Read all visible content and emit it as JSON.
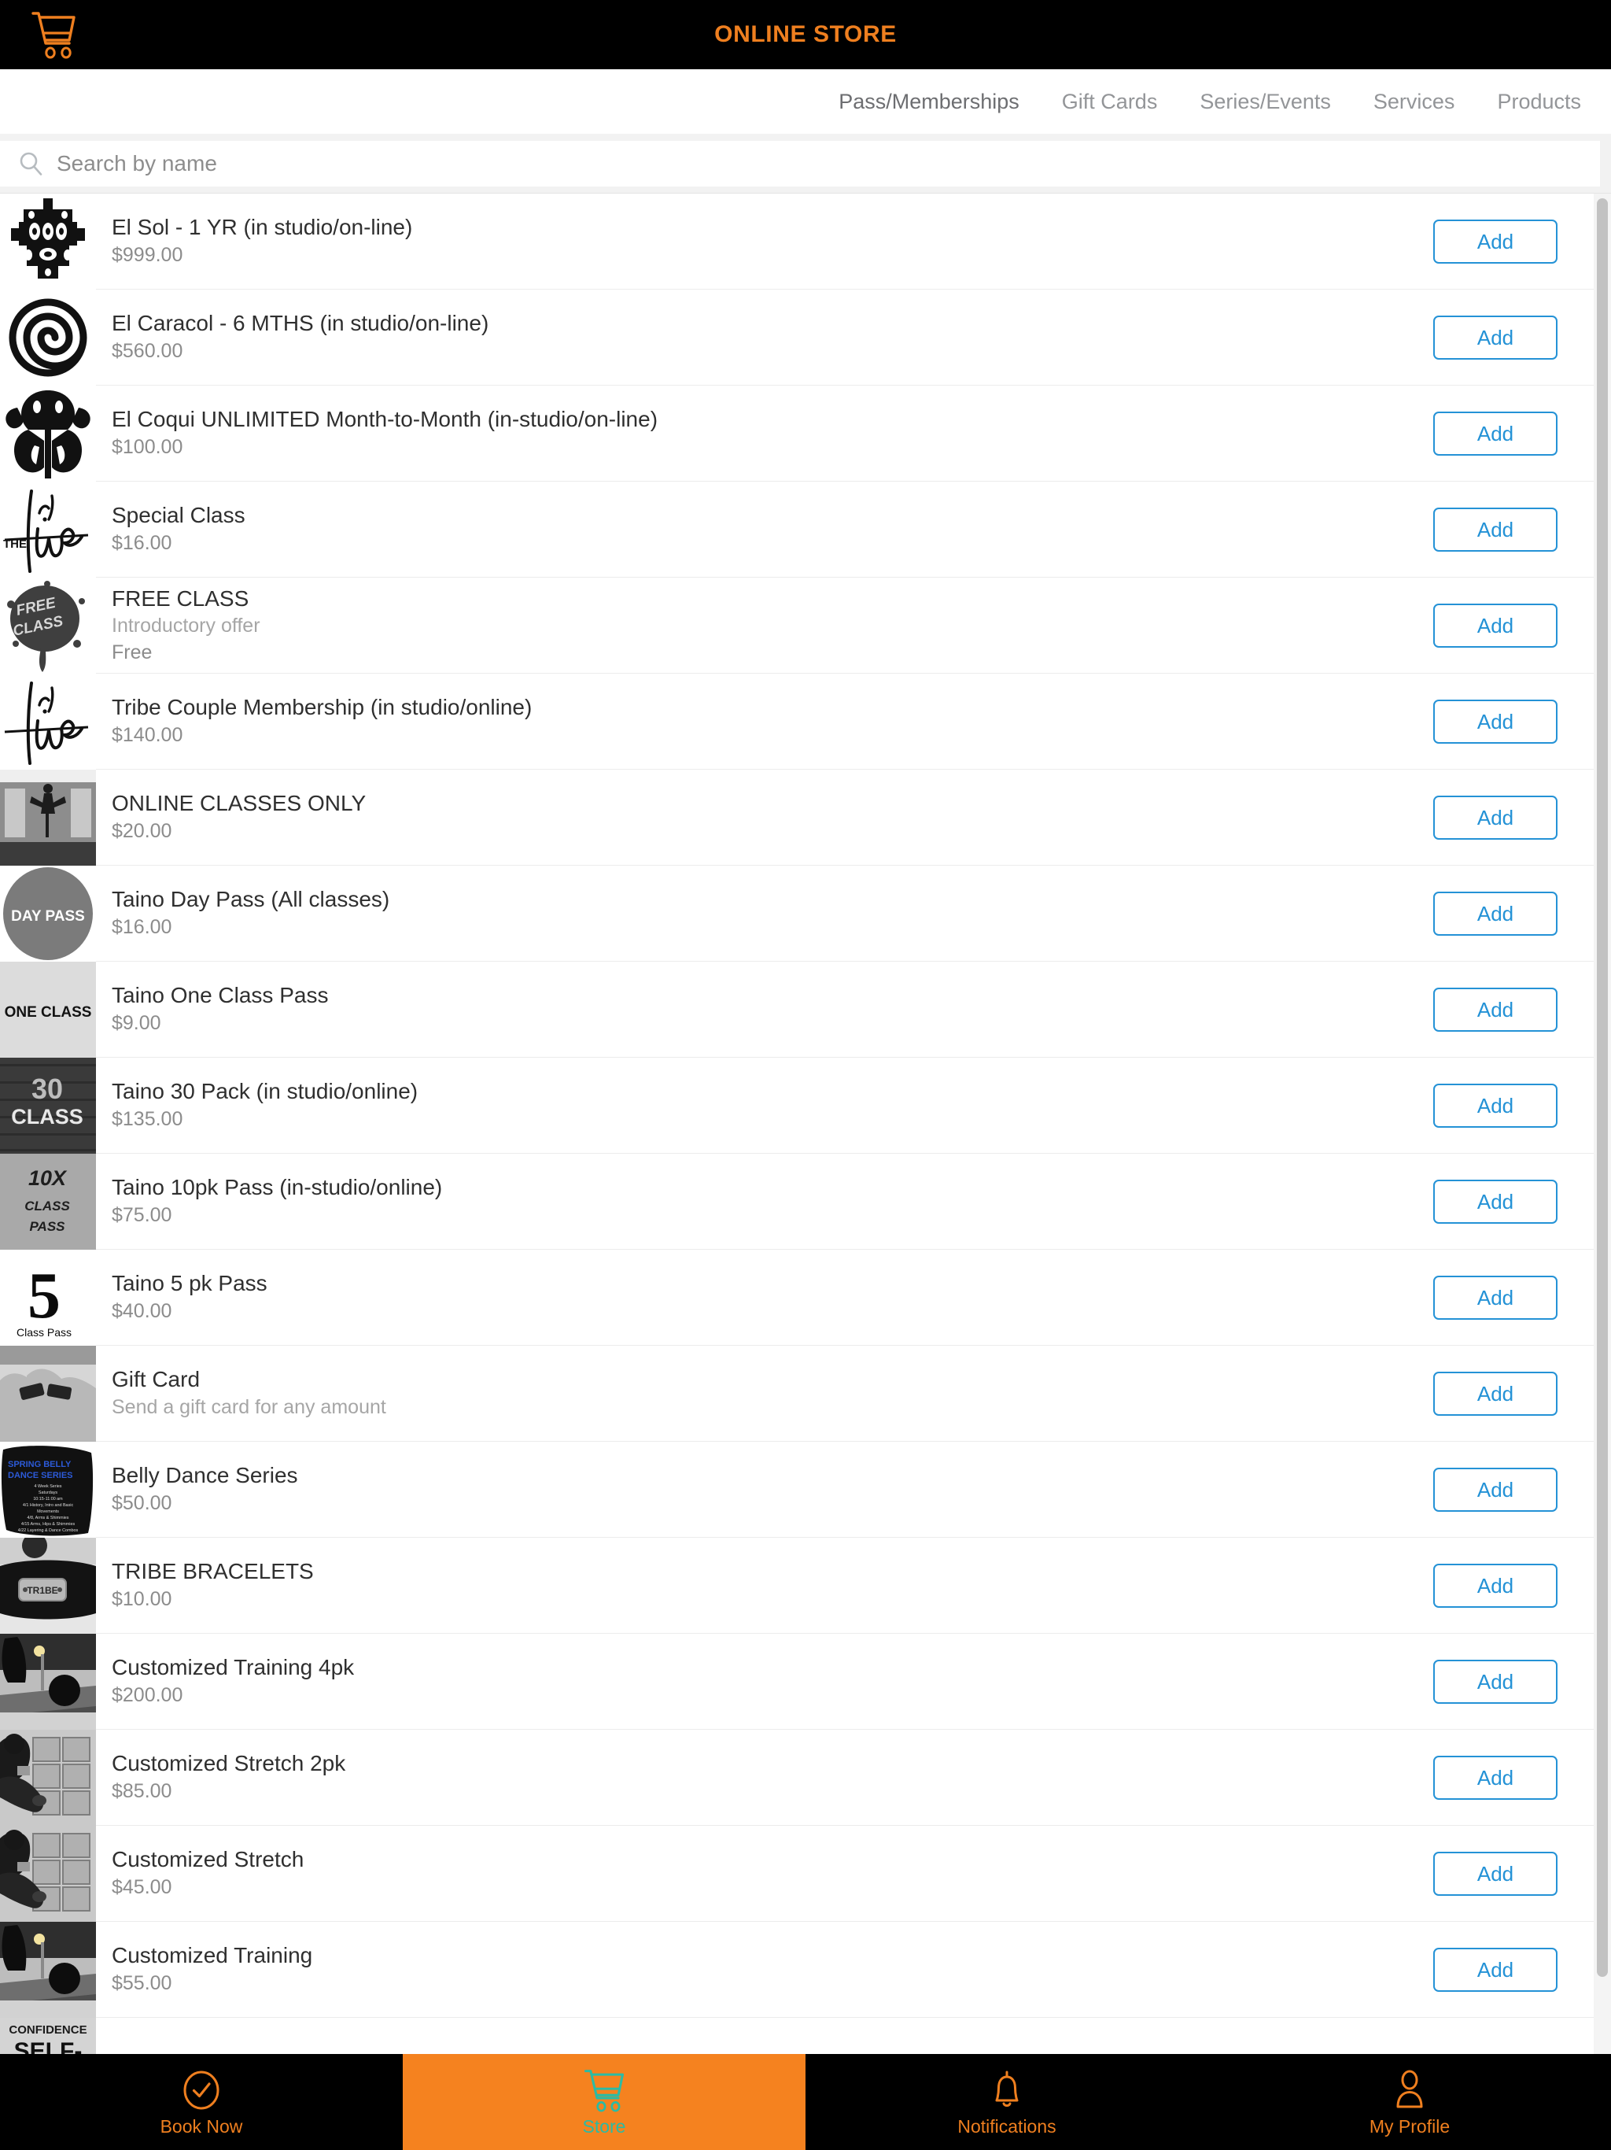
{
  "header": {
    "title": "ONLINE STORE",
    "cart_icon": "shopping-cart-icon",
    "accent_color": "#ef7f1f",
    "background_color": "#000000"
  },
  "nav": {
    "tabs": [
      {
        "label": "Pass/Memberships",
        "active": true
      },
      {
        "label": "Gift Cards",
        "active": false
      },
      {
        "label": "Series/Events",
        "active": false
      },
      {
        "label": "Services",
        "active": false
      },
      {
        "label": "Products",
        "active": false
      }
    ]
  },
  "search": {
    "placeholder": "Search by name",
    "value": "",
    "icon": "search-icon"
  },
  "products": [
    {
      "title": "El Sol - 1 YR (in studio/on-line)",
      "subtitle": "",
      "price": "$999.00",
      "action": "Add",
      "thumb": "el-sol-taino-sun-glyph"
    },
    {
      "title": "El Caracol - 6 MTHS (in studio/on-line)",
      "subtitle": "",
      "price": "$560.00",
      "action": "Add",
      "thumb": "el-caracol-spiral-glyph"
    },
    {
      "title": "El Coqui UNLIMITED Month-to-Month (in-studio/on-line)",
      "subtitle": "",
      "price": "$100.00",
      "action": "Add",
      "thumb": "el-coqui-frog-glyph"
    },
    {
      "title": "Special Class",
      "subtitle": "",
      "price": "$16.00",
      "action": "Add",
      "thumb": "the-tribe-script-logo"
    },
    {
      "title": "FREE CLASS",
      "subtitle": "Introductory offer",
      "price": "Free",
      "action": "Add",
      "thumb": "free-class-splat-badge"
    },
    {
      "title": "Tribe Couple Membership (in studio/online)",
      "subtitle": "",
      "price": "$140.00",
      "action": "Add",
      "thumb": "tribe-script-logo"
    },
    {
      "title": "ONLINE CLASSES ONLY",
      "subtitle": "",
      "price": "$20.00",
      "action": "Add",
      "thumb": "online-class-photo"
    },
    {
      "title": "Taino Day Pass (All classes)",
      "subtitle": "",
      "price": "$16.00",
      "action": "Add",
      "thumb": "day-pass-circle-badge"
    },
    {
      "title": "Taino One Class Pass",
      "subtitle": "",
      "price": "$9.00",
      "action": "Add",
      "thumb": "one-class-badge"
    },
    {
      "title": "Taino 30 Pack (in studio/online)",
      "subtitle": "",
      "price": "$135.00",
      "action": "Add",
      "thumb": "thirty-class-badge"
    },
    {
      "title": "Taino 10pk Pass (in-studio/online)",
      "subtitle": "",
      "price": "$75.00",
      "action": "Add",
      "thumb": "ten-x-class-pass-badge"
    },
    {
      "title": "Taino 5 pk Pass",
      "subtitle": "",
      "price": "$40.00",
      "action": "Add",
      "thumb": "five-class-pass-badge"
    },
    {
      "title": "Gift Card",
      "subtitle": "Send a gift card for any amount",
      "price": "",
      "action": "Add",
      "thumb": "gift-card-photo"
    },
    {
      "title": "Belly Dance Series",
      "subtitle": "",
      "price": "$50.00",
      "action": "Add",
      "thumb": "spring-belly-dance-series-flyer"
    },
    {
      "title": "TRIBE BRACELETS",
      "subtitle": "",
      "price": "$10.00",
      "action": "Add",
      "thumb": "tribe-bracelet-photo"
    },
    {
      "title": "Customized Training 4pk",
      "subtitle": "",
      "price": "$200.00",
      "action": "Add",
      "thumb": "training-gym-photo"
    },
    {
      "title": "Customized Stretch 2pk",
      "subtitle": "",
      "price": "$85.00",
      "action": "Add",
      "thumb": "stretch-coach-photo"
    },
    {
      "title": "Customized Stretch",
      "subtitle": "",
      "price": "$45.00",
      "action": "Add",
      "thumb": "stretch-coach-photo"
    },
    {
      "title": "Customized Training",
      "subtitle": "",
      "price": "$55.00",
      "action": "Add",
      "thumb": "training-gym-photo"
    },
    {
      "title": "",
      "subtitle": "",
      "price": "",
      "action": "",
      "thumb": "self-defense-badge"
    }
  ],
  "bottom_tabs": [
    {
      "label": "Book Now",
      "icon": "check-circle-icon",
      "active": false
    },
    {
      "label": "Store",
      "icon": "shopping-cart-icon",
      "active": true
    },
    {
      "label": "Notifications",
      "icon": "bell-icon",
      "active": false
    },
    {
      "label": "My Profile",
      "icon": "person-icon",
      "active": false
    }
  ],
  "colors": {
    "brand_orange": "#f5821f",
    "header_orange": "#ef7f1f",
    "active_tab_teal": "#2bbba4",
    "add_button_blue": "#2492d6",
    "black": "#000000"
  }
}
